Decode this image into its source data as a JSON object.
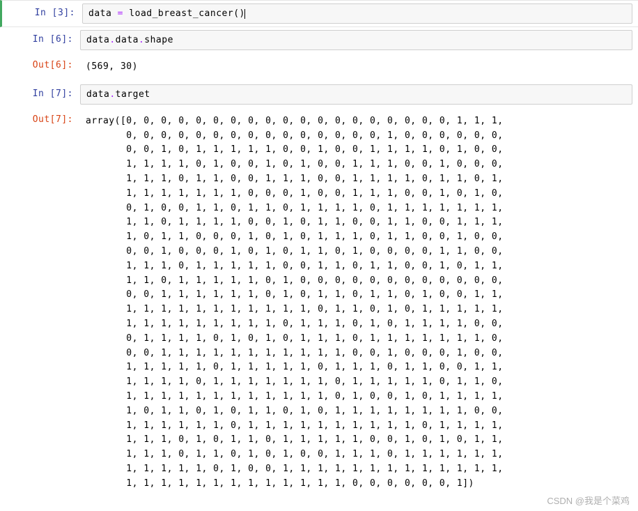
{
  "cells": [
    {
      "prompt_in": "In  [3]:",
      "code_tokens": [
        {
          "t": "data ",
          "c": "tok-var"
        },
        {
          "t": "=",
          "c": "tok-op"
        },
        {
          "t": " load_breast_cancer",
          "c": "tok-func"
        },
        {
          "t": "()",
          "c": "tok-paren"
        }
      ]
    },
    {
      "prompt_in": "In  [6]:",
      "code_tokens": [
        {
          "t": "data",
          "c": "tok-var"
        },
        {
          "t": ".",
          "c": "tok-op"
        },
        {
          "t": "data",
          "c": "tok-attr"
        },
        {
          "t": ".",
          "c": "tok-op"
        },
        {
          "t": "shape",
          "c": "tok-attr"
        }
      ],
      "prompt_out": "Out[6]:",
      "output": "(569, 30)"
    },
    {
      "prompt_in": "In  [7]:",
      "code_tokens": [
        {
          "t": "data",
          "c": "tok-var"
        },
        {
          "t": ".",
          "c": "tok-op"
        },
        {
          "t": "target",
          "c": "tok-attr"
        }
      ],
      "prompt_out": "Out[7]:",
      "output_lines": [
        "array([0, 0, 0, 0, 0, 0, 0, 0, 0, 0, 0, 0, 0, 0, 0, 0, 0, 0, 0, 1, 1, 1,",
        "       0, 0, 0, 0, 0, 0, 0, 0, 0, 0, 0, 0, 0, 0, 0, 1, 0, 0, 0, 0, 0, 0,",
        "       0, 0, 1, 0, 1, 1, 1, 1, 1, 0, 0, 1, 0, 0, 1, 1, 1, 1, 0, 1, 0, 0,",
        "       1, 1, 1, 1, 0, 1, 0, 0, 1, 0, 1, 0, 0, 1, 1, 1, 0, 0, 1, 0, 0, 0,",
        "       1, 1, 1, 0, 1, 1, 0, 0, 1, 1, 1, 0, 0, 1, 1, 1, 1, 0, 1, 1, 0, 1,",
        "       1, 1, 1, 1, 1, 1, 1, 0, 0, 0, 1, 0, 0, 1, 1, 1, 0, 0, 1, 0, 1, 0,",
        "       0, 1, 0, 0, 1, 1, 0, 1, 1, 0, 1, 1, 1, 1, 0, 1, 1, 1, 1, 1, 1, 1,",
        "       1, 1, 0, 1, 1, 1, 1, 0, 0, 1, 0, 1, 1, 0, 0, 1, 1, 0, 0, 1, 1, 1,",
        "       1, 0, 1, 1, 0, 0, 0, 1, 0, 1, 0, 1, 1, 1, 0, 1, 1, 0, 0, 1, 0, 0,",
        "       0, 0, 1, 0, 0, 0, 1, 0, 1, 0, 1, 1, 0, 1, 0, 0, 0, 0, 1, 1, 0, 0,",
        "       1, 1, 1, 0, 1, 1, 1, 1, 1, 0, 0, 1, 1, 0, 1, 1, 0, 0, 1, 0, 1, 1,",
        "       1, 1, 0, 1, 1, 1, 1, 1, 0, 1, 0, 0, 0, 0, 0, 0, 0, 0, 0, 0, 0, 0,",
        "       0, 0, 1, 1, 1, 1, 1, 1, 0, 1, 0, 1, 1, 0, 1, 1, 0, 1, 0, 0, 1, 1,",
        "       1, 1, 1, 1, 1, 1, 1, 1, 1, 1, 1, 0, 1, 1, 0, 1, 0, 1, 1, 1, 1, 1,",
        "       1, 1, 1, 1, 1, 1, 1, 1, 1, 0, 1, 1, 1, 0, 1, 0, 1, 1, 1, 1, 0, 0,",
        "       0, 1, 1, 1, 1, 0, 1, 0, 1, 0, 1, 1, 1, 0, 1, 1, 1, 1, 1, 1, 1, 0,",
        "       0, 0, 1, 1, 1, 1, 1, 1, 1, 1, 1, 1, 1, 0, 0, 1, 0, 0, 0, 1, 0, 0,",
        "       1, 1, 1, 1, 1, 0, 1, 1, 1, 1, 1, 0, 1, 1, 1, 0, 1, 1, 0, 0, 1, 1,",
        "       1, 1, 1, 1, 0, 1, 1, 1, 1, 1, 1, 1, 0, 1, 1, 1, 1, 1, 0, 1, 1, 0,",
        "       1, 1, 1, 1, 1, 1, 1, 1, 1, 1, 1, 1, 0, 1, 0, 0, 1, 0, 1, 1, 1, 1,",
        "       1, 0, 1, 1, 0, 1, 0, 1, 1, 0, 1, 0, 1, 1, 1, 1, 1, 1, 1, 1, 0, 0,",
        "       1, 1, 1, 1, 1, 1, 0, 1, 1, 1, 1, 1, 1, 1, 1, 1, 1, 0, 1, 1, 1, 1,",
        "       1, 1, 1, 0, 1, 0, 1, 1, 0, 1, 1, 1, 1, 1, 0, 0, 1, 0, 1, 0, 1, 1,",
        "       1, 1, 1, 0, 1, 1, 0, 1, 0, 1, 0, 0, 1, 1, 1, 0, 1, 1, 1, 1, 1, 1,",
        "       1, 1, 1, 1, 1, 0, 1, 0, 0, 1, 1, 1, 1, 1, 1, 1, 1, 1, 1, 1, 1, 1,",
        "       1, 1, 1, 1, 1, 1, 1, 1, 1, 1, 1, 1, 1, 0, 0, 0, 0, 0, 0, 1])"
      ]
    }
  ],
  "watermark": "CSDN @我是个菜鸡"
}
